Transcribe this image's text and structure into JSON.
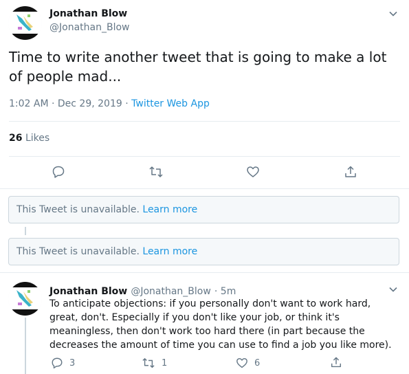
{
  "main_tweet": {
    "author_name": "Jonathan Blow",
    "author_handle": "@Jonathan_Blow",
    "text": "Time to write another tweet that is going to make a lot of people mad...",
    "time": "1:02 AM · Dec 29, 2019",
    "separator": " · ",
    "app": "Twitter Web App",
    "likes_count": "26",
    "likes_label": "Likes"
  },
  "unavailable_tweets": [
    {
      "text": "This Tweet is unavailable.",
      "link": "Learn more"
    },
    {
      "text": "This Tweet is unavailable.",
      "link": "Learn more"
    }
  ],
  "reply": {
    "author_name": "Jonathan Blow",
    "author_handle": "@Jonathan_Blow",
    "time": "· 5m",
    "text": "To anticipate objections: if you personally don't want to work hard, great, don't. Especially if you don't like your job, or think it's meaningless, then don't work too hard there (in part because the decreases the amount of time you can use to find a job you like more).",
    "reply_count": "3",
    "retweet_count": "1",
    "like_count": "6"
  },
  "colors": {
    "link": "#1b95e0",
    "secondary_text": "#657786",
    "icon": "#657786",
    "border": "#e6ecf0"
  },
  "icons": [
    "chevron-down-icon",
    "reply-icon",
    "retweet-icon",
    "like-icon",
    "share-icon"
  ]
}
